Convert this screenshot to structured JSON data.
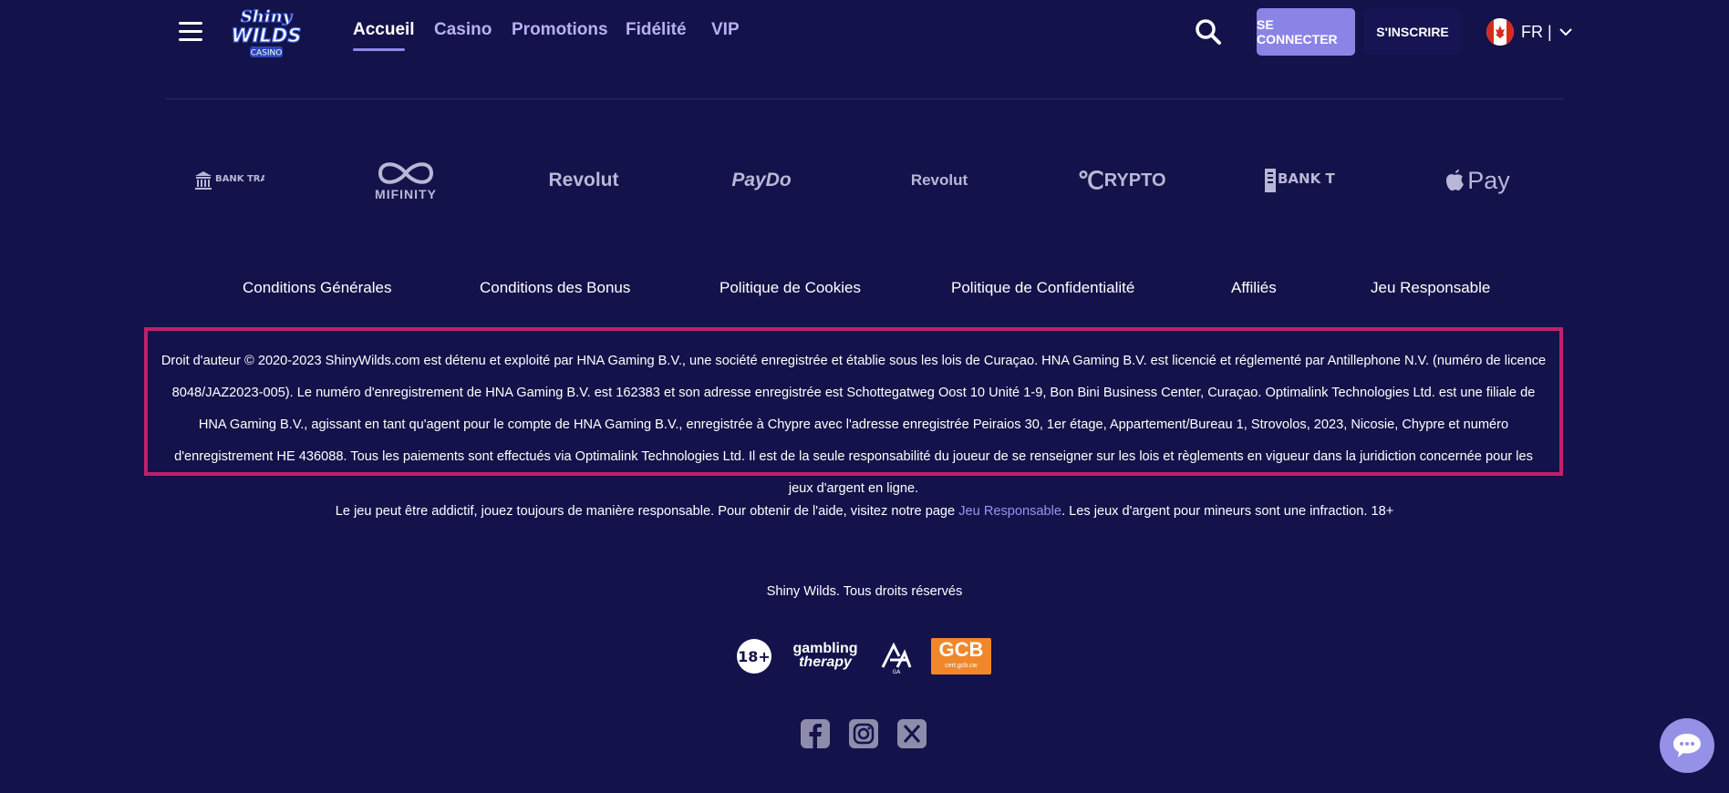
{
  "header": {
    "logo_alt": "Shiny Wilds Casino",
    "logo_line1": "Shiny",
    "logo_line2": "WILDS",
    "logo_line3": "CASINO",
    "nav": [
      {
        "label": "Accueil",
        "active": true
      },
      {
        "label": "Casino"
      },
      {
        "label": "Promotions"
      },
      {
        "label": "Fidélité"
      },
      {
        "label": "VIP"
      }
    ],
    "login_label": "SE CONNECTER",
    "register_label": "S'INSCRIRE",
    "language": "FR |"
  },
  "payments": [
    "BANK TRANSFER",
    "MIFINITY",
    "Revolut",
    "PayDo",
    "Revolut",
    "RYPTO",
    "BANK TRANSFER",
    "Pay"
  ],
  "footer_links": [
    "Conditions Générales",
    "Conditions des Bonus",
    "Politique de Cookies",
    "Politique de Confidentialité",
    "Affiliés",
    "Jeu Responsable"
  ],
  "legal_text": "Droit d'auteur © 2020-2023 ShinyWilds.com est détenu et exploité par HNA Gaming B.V., une société enregistrée et établie sous les lois de Curaçao. HNA Gaming B.V. est licencié et réglementé par Antillephone N.V. (numéro de licence 8048/JAZ2023-005). Le numéro d'enregistrement de HNA Gaming B.V. est 162383 et son adresse enregistrée est Schottegatweg Oost 10 Unité 1-9, Bon Bini Business Center, Curaçao. Optimalink Technologies Ltd. est une filiale de HNA Gaming B.V., agissant en tant qu'agent pour le compte de HNA Gaming B.V., enregistrée à Chypre avec l'adresse enregistrée Peiraios 30, 1er étage, Appartement/Bureau 1, Strovolos, 2023, Nicosie, Chypre et numéro d'enregistrement HE 436088. Tous les paiements sont effectués via Optimalink Technologies Ltd. Il est de la seule responsabilité du joueur de se renseigner sur les lois et règlements en vigueur dans la juridiction concernée pour les jeux d'argent en ligne.",
  "responsible": {
    "before": "Le jeu peut être addictif, jouez toujours de manière responsable. Pour obtenir de l'aide, visitez notre page ",
    "link": "Jeu Responsable",
    "after": ". Les jeux d'argent pour mineurs sont une infraction. 18+"
  },
  "rights": "Shiny Wilds. Tous droits réservés",
  "badges": {
    "age": "18+",
    "gambling_line1": "gambling",
    "gambling_line2": "therapy",
    "ga": "GA",
    "gcb": "GCB",
    "gcb_sub": "cert.gcb.cw"
  },
  "colors": {
    "background": "#14124a",
    "accent": "#8a84e6",
    "legal_border": "#c0206e",
    "link": "#9a93f0"
  }
}
